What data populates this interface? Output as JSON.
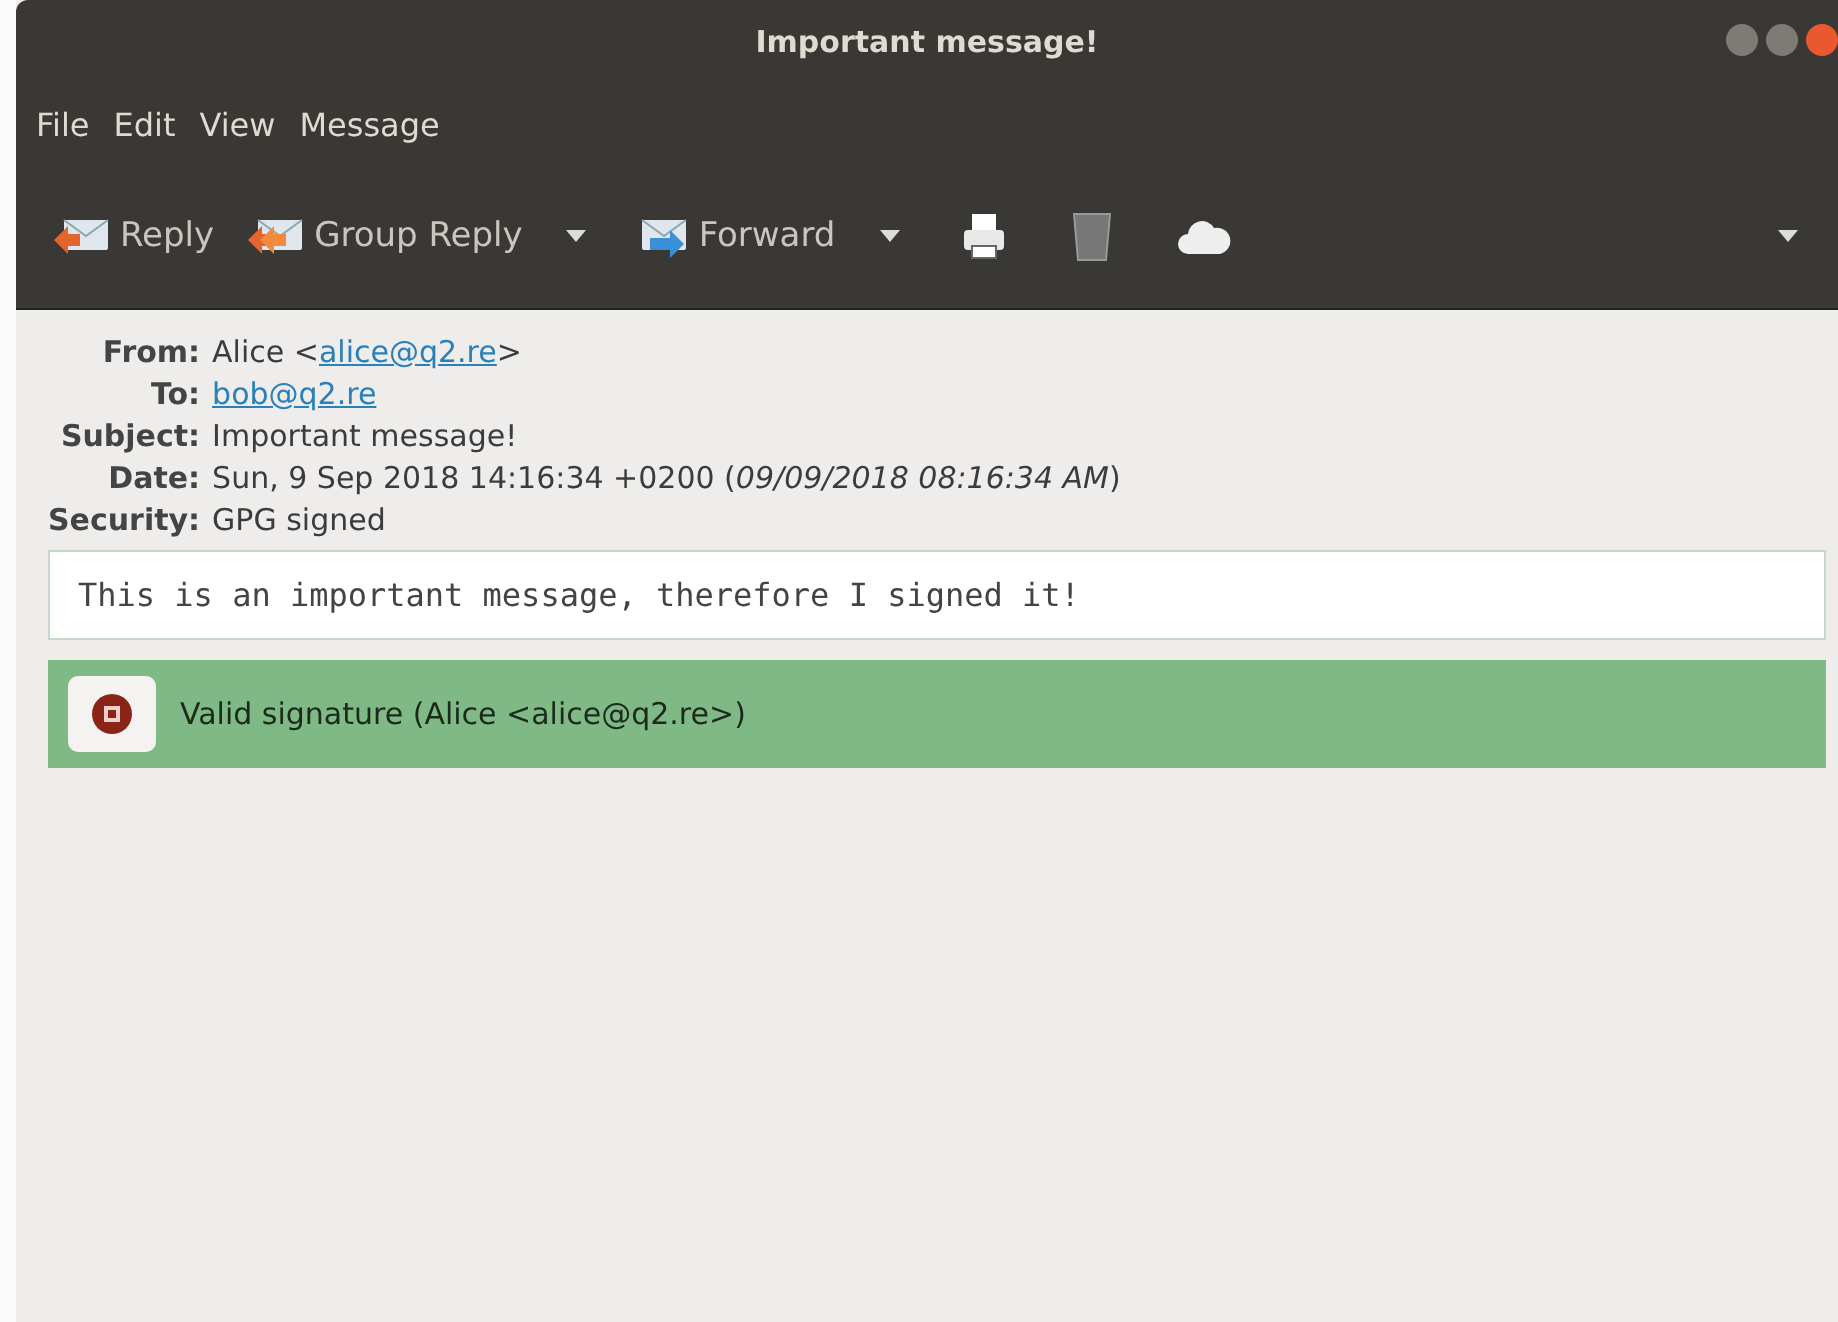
{
  "window": {
    "title": "Important message!"
  },
  "menu": [
    "File",
    "Edit",
    "View",
    "Message"
  ],
  "toolbar": [
    {
      "kind": "reply",
      "label": "Reply"
    },
    {
      "kind": "groupreply",
      "label": "Group Reply"
    },
    {
      "kind": "dropdown"
    },
    {
      "kind": "forward",
      "label": "Forward"
    },
    {
      "kind": "dropdown"
    },
    {
      "kind": "print"
    },
    {
      "kind": "trash"
    },
    {
      "kind": "cloud"
    },
    {
      "kind": "overflow"
    }
  ],
  "headers": [
    {
      "label": "From:",
      "prefix": "Alice <",
      "link": "alice@q2.re",
      "suffix": ">"
    },
    {
      "label": "To:",
      "link": "bob@q2.re"
    },
    {
      "label": "Subject:",
      "value": "Important message!"
    },
    {
      "label": "Date:",
      "value": "Sun, 9 Sep 2018 14:16:34 +0200 (*09/09/2018 08:16:34 AM*)"
    },
    {
      "label": "Security:",
      "value": "GPG signed"
    }
  ],
  "body": "This is an important message, therefore I signed it!",
  "signature": {
    "text": "Valid signature (Alice <alice@q2.re>)",
    "valid": true
  }
}
